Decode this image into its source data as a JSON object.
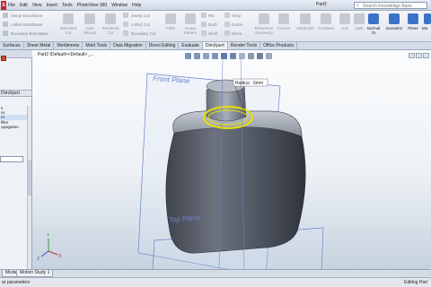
{
  "app": {
    "logo": "S",
    "doc_title": "Part2"
  },
  "menu": [
    "File",
    "Edit",
    "View",
    "Insert",
    "Tools",
    "PhotoView 360",
    "Window",
    "Help"
  ],
  "search": {
    "placeholder": "Search Knowledge Base"
  },
  "ribbon": {
    "boss_group": [
      "Swept Boss/Base",
      "Lofted Boss/Base",
      "Boundary Boss/Base"
    ],
    "cut_labels": [
      {
        "l1": "Extruded",
        "l2": "Cut"
      },
      {
        "l1": "Hole",
        "l2": "Wizard"
      },
      {
        "l1": "Revolved",
        "l2": "Cut"
      }
    ],
    "cut_group": [
      "Swept Cut",
      "Lofted Cut",
      "Boundary Cut"
    ],
    "feature_labels": [
      {
        "l1": "Fillet",
        "l2": ""
      },
      {
        "l1": "Linear",
        "l2": "Pattern"
      }
    ],
    "small_features": [
      {
        "name": "rib",
        "label": "Rib"
      },
      {
        "name": "draft",
        "label": "Draft"
      },
      {
        "name": "shell",
        "label": "Shell"
      },
      {
        "name": "wrap",
        "label": "Wrap"
      },
      {
        "name": "dome",
        "label": "Dome"
      },
      {
        "name": "mirror",
        "label": "Mirror"
      }
    ],
    "right_labels": [
      {
        "l1": "Reference",
        "l2": "Geometry"
      },
      {
        "l1": "Curves",
        "l2": ""
      }
    ],
    "far_right": [
      {
        "l1": "Instant3D",
        "l2": ""
      },
      {
        "l1": "Combine",
        "l2": ""
      },
      {
        "l1": "Join",
        "l2": ""
      },
      {
        "l1": "Split",
        "l2": ""
      },
      {
        "l1": "Normal",
        "l2": "To"
      },
      {
        "l1": "Isometric",
        "l2": ""
      },
      {
        "l1": "Plane",
        "l2": ""
      },
      {
        "l1": "Ma",
        "l2": ""
      }
    ]
  },
  "tabs": [
    "Surfaces",
    "Sheet Metal",
    "Weldments",
    "Mold Tools",
    "Data Migration",
    "Direct Editing",
    "Evaluate",
    "DimXpert",
    "Render Tools",
    "Office Products"
  ],
  "left_panel": {
    "tab": "DimXpert",
    "list": [
      "s",
      "ss",
      "",
      "nt",
      "",
      "",
      "",
      "",
      "",
      "",
      "",
      "fillet",
      "",
      "opagation",
      "",
      "",
      "",
      "",
      ""
    ],
    "selected_index": 3
  },
  "viewport": {
    "tree_label": "Part2  (Default<<Default>_...",
    "front_plane": "Front Plane",
    "top_plane": "Top Plane",
    "dim_label": "Radius:",
    "dim_value": "6mm",
    "axis": {
      "x": "X",
      "y": "Y",
      "z": "Z"
    }
  },
  "colors": {
    "body_dark": "#4a505c",
    "body_light": "#a9aeb8",
    "selection": "#e8e000",
    "plane": "#6a82c8"
  },
  "bottom": {
    "tabs": [
      "Model",
      "Motion Study 1"
    ]
  },
  "status": {
    "left": "ar parameters",
    "right": "Editing Part"
  }
}
